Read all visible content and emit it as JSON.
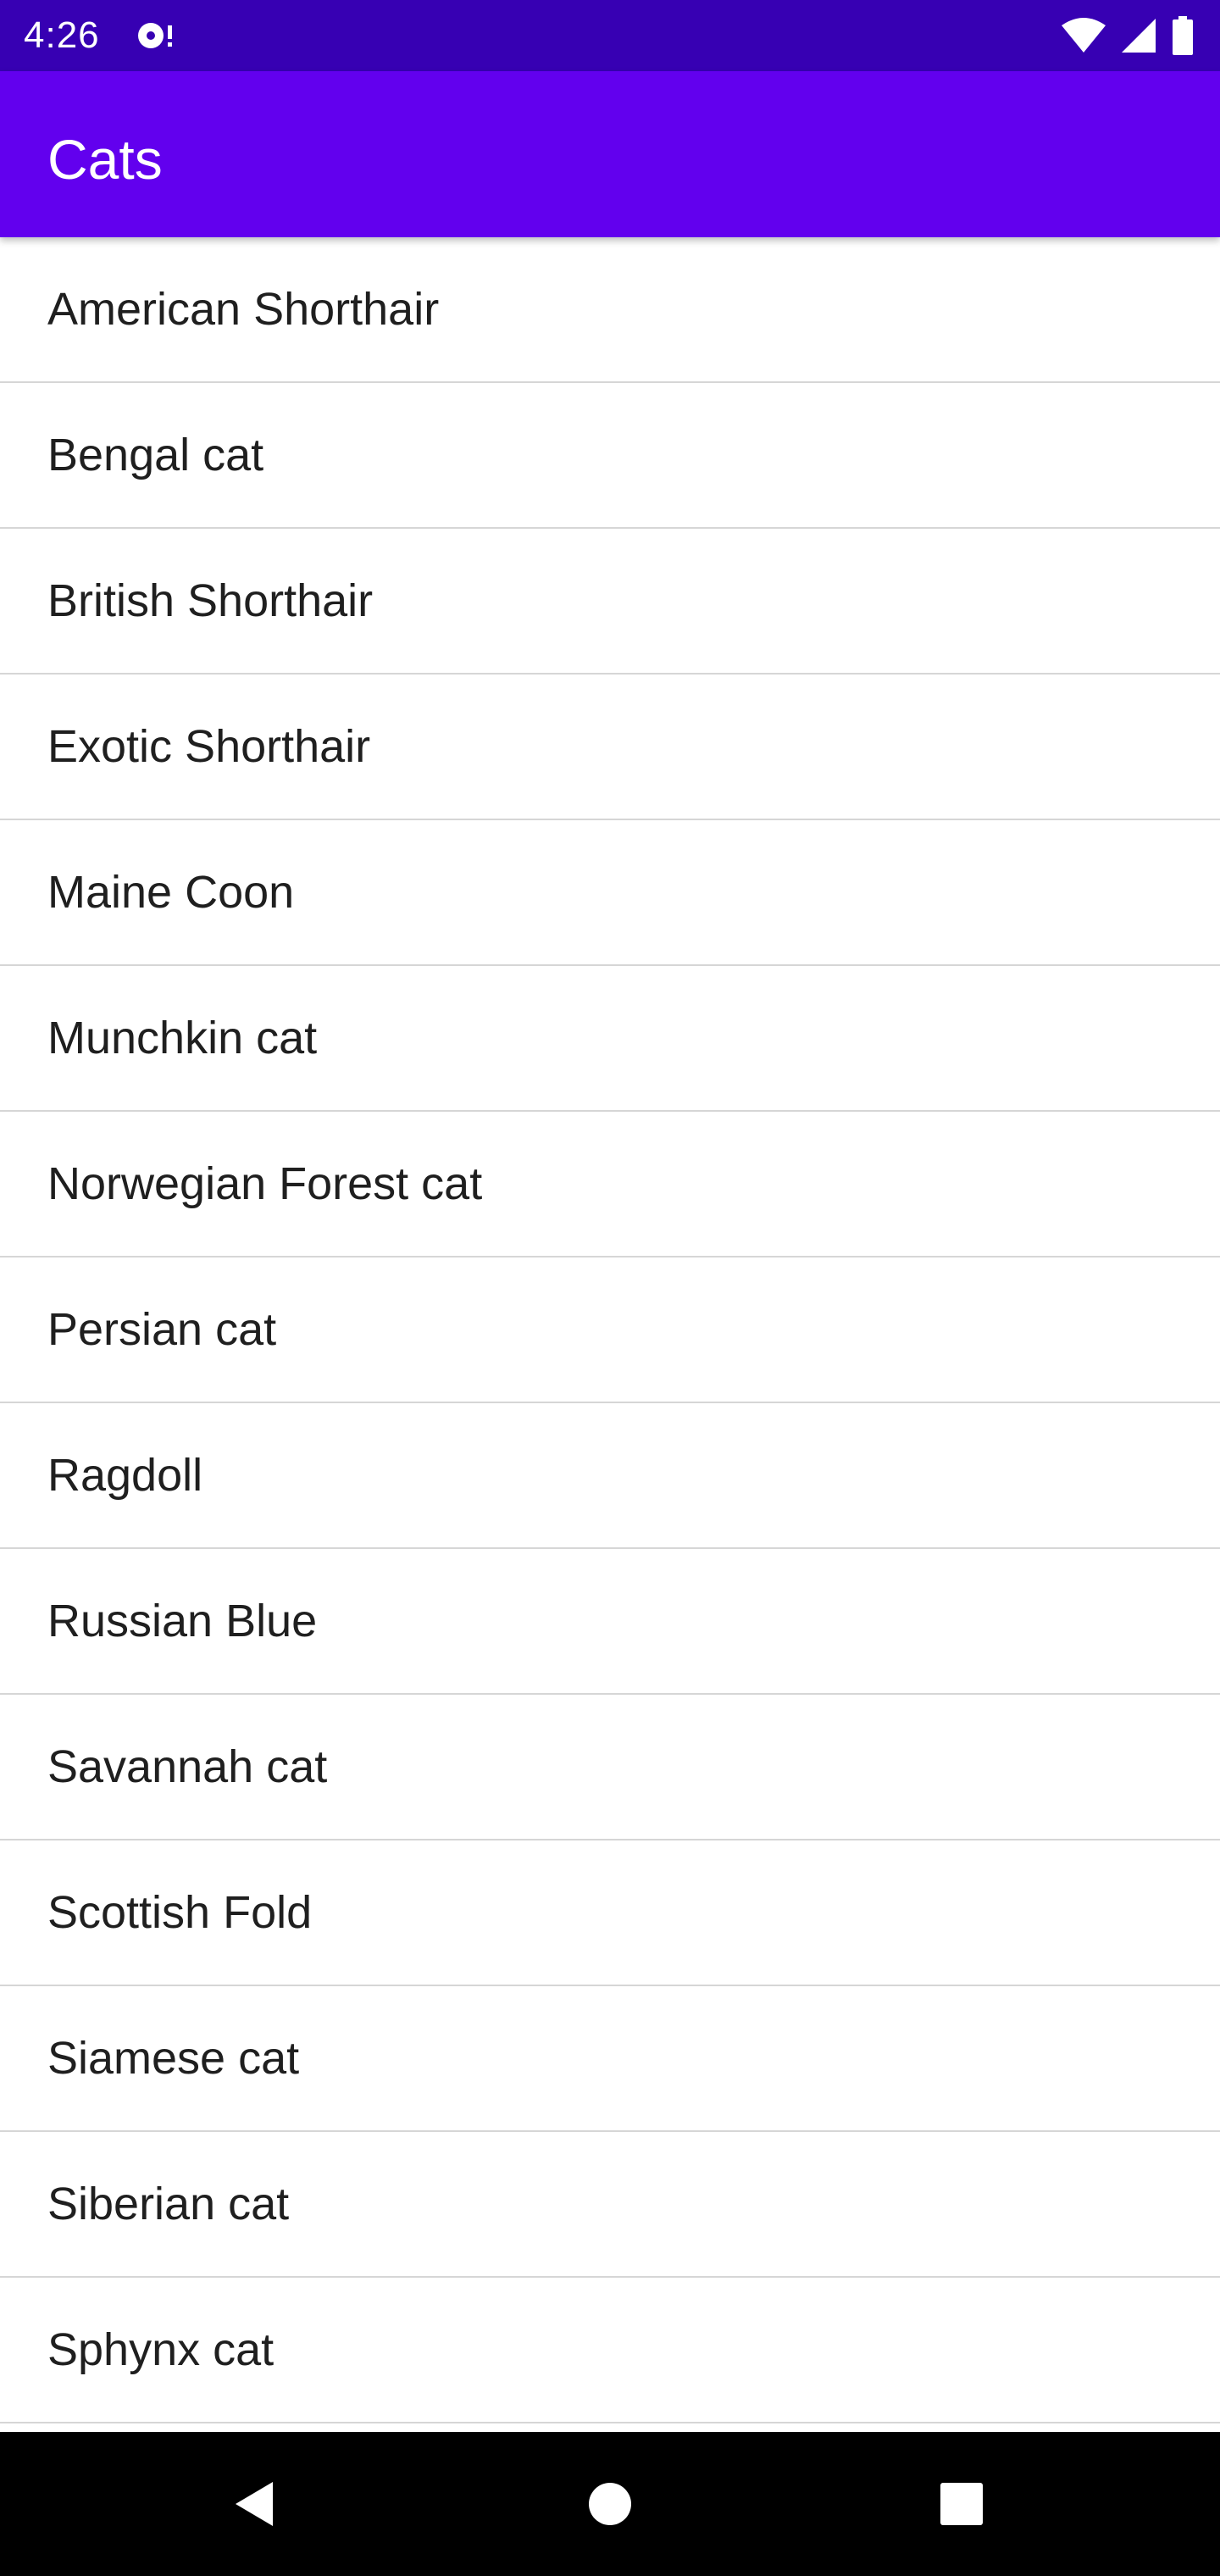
{
  "status_bar": {
    "time": "4:26",
    "icons": [
      "notification-icon",
      "wifi-icon",
      "cellular-signal-icon",
      "battery-icon"
    ],
    "color": "#3700b3"
  },
  "app_bar": {
    "title": "Cats",
    "color": "#6200ee"
  },
  "list": {
    "items": [
      {
        "label": "American Shorthair"
      },
      {
        "label": "Bengal cat"
      },
      {
        "label": "British Shorthair"
      },
      {
        "label": "Exotic Shorthair"
      },
      {
        "label": "Maine Coon"
      },
      {
        "label": "Munchkin cat"
      },
      {
        "label": "Norwegian Forest cat"
      },
      {
        "label": "Persian cat"
      },
      {
        "label": "Ragdoll"
      },
      {
        "label": "Russian Blue"
      },
      {
        "label": "Savannah cat"
      },
      {
        "label": "Scottish Fold"
      },
      {
        "label": "Siamese cat"
      },
      {
        "label": "Siberian cat"
      },
      {
        "label": "Sphynx cat"
      }
    ]
  },
  "nav_bar": {
    "buttons": [
      "back-icon",
      "home-icon",
      "recents-icon"
    ]
  }
}
